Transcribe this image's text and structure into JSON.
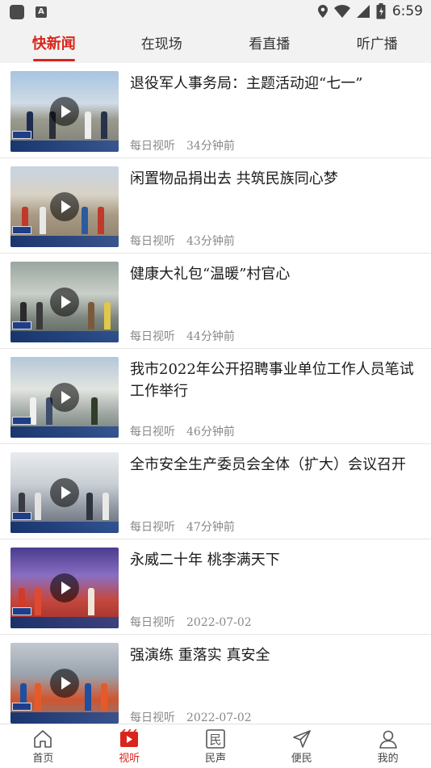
{
  "status_bar": {
    "time": "6:59"
  },
  "tabs": [
    {
      "label": "快新闻",
      "active": true
    },
    {
      "label": "在现场",
      "active": false
    },
    {
      "label": "看直播",
      "active": false
    },
    {
      "label": "听广播",
      "active": false
    }
  ],
  "items": [
    {
      "title": "退役军人事务局：主题活动迎“七一”",
      "source": "每日视听",
      "time": "34分钟前"
    },
    {
      "title": "闲置物品捐出去 共筑民族同心梦",
      "source": "每日视听",
      "time": "43分钟前"
    },
    {
      "title": "健康大礼包“温暖”村官心",
      "source": "每日视听",
      "time": "44分钟前"
    },
    {
      "title": "我市2022年公开招聘事业单位工作人员笔试工作举行",
      "source": "每日视听",
      "time": "46分钟前"
    },
    {
      "title": "全市安全生产委员会全体（扩大）会议召开",
      "source": "每日视听",
      "time": "47分钟前"
    },
    {
      "title": "永威二十年 桃李满天下",
      "source": "每日视听",
      "time": "2022-07-02"
    },
    {
      "title": "强演练 重落实 真安全",
      "source": "每日视听",
      "time": "2022-07-02"
    }
  ],
  "bottom_nav": [
    {
      "label": "首页",
      "icon": "home-icon",
      "active": false
    },
    {
      "label": "视听",
      "icon": "video-icon",
      "active": true
    },
    {
      "label": "民声",
      "icon": "min-voice-icon",
      "active": false
    },
    {
      "label": "便民",
      "icon": "send-icon",
      "active": false
    },
    {
      "label": "我的",
      "icon": "user-icon",
      "active": false
    }
  ],
  "colors": {
    "accent": "#d9251c"
  }
}
